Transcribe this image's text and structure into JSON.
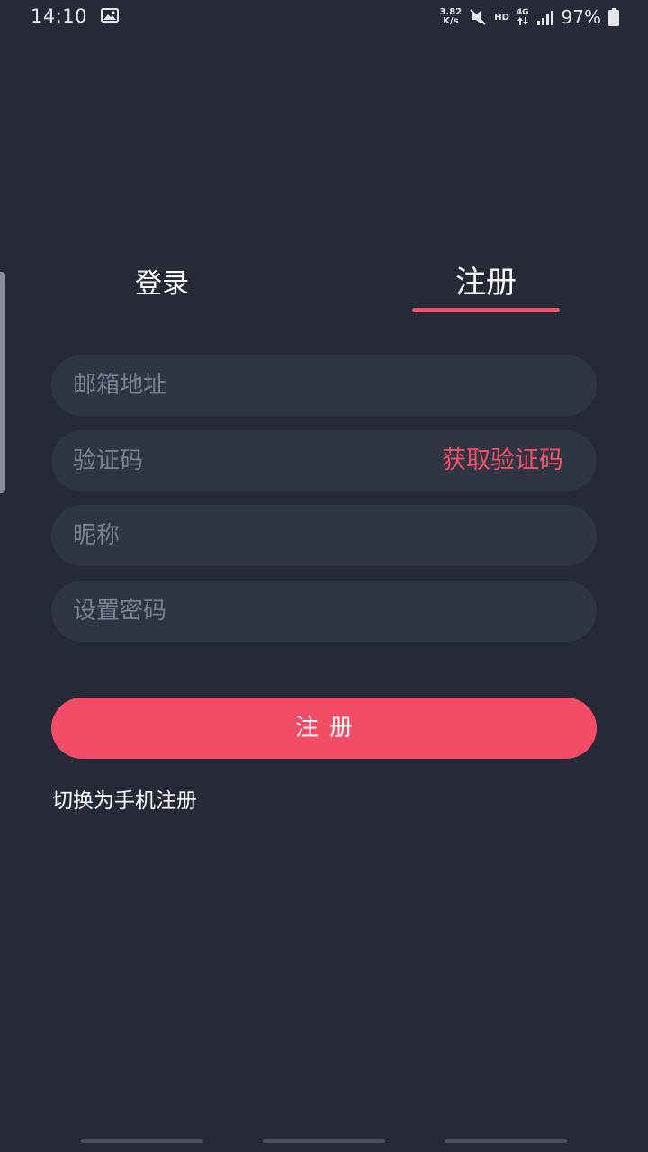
{
  "status_bar": {
    "time": "14:10",
    "net_speed_value": "3.82",
    "net_speed_unit": "K/s",
    "hd_label": "HD",
    "network_type": "4G",
    "battery_percent": "97%"
  },
  "tabs": {
    "login_label": "登录",
    "register_label": "注册",
    "active": "register"
  },
  "form": {
    "email_placeholder": "邮箱地址",
    "code_placeholder": "验证码",
    "get_code_label": "获取验证码",
    "nickname_placeholder": "昵称",
    "password_placeholder": "设置密码",
    "email_value": "",
    "code_value": "",
    "nickname_value": "",
    "password_value": ""
  },
  "submit_label": "注册",
  "switch_link_label": "切换为手机注册",
  "colors": {
    "background": "#252938",
    "field_background": "#303543",
    "accent": "#f34c67",
    "placeholder": "#7b8193"
  }
}
